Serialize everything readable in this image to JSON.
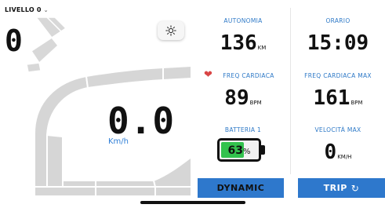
{
  "assist": {
    "label": "LIVELLO 0",
    "value": "0"
  },
  "speed": {
    "value": "0.0",
    "unit": "Km/h"
  },
  "stats": {
    "autonomia": {
      "label": "AUTONOMIA",
      "value": "136",
      "unit": "KM"
    },
    "orario": {
      "label": "ORARIO",
      "value": "15:09"
    },
    "freq_cardiaca": {
      "label": "FREQ CARDIACA",
      "value": "89",
      "unit": "BPM"
    },
    "freq_cardiaca_max": {
      "label": "FREQ CARDIACA MAX",
      "value": "161",
      "unit": "BPM"
    },
    "batteria": {
      "label": "BATTERIA 1",
      "value": "63",
      "unit": "%",
      "level": 0.63
    },
    "velocita_max": {
      "label": "VELOCITÀ MAX",
      "value": "0",
      "unit": "KM/H"
    }
  },
  "buttons": {
    "mode": "DYNAMIC",
    "trip": "TRIP"
  },
  "colors": {
    "accent": "#2e78cc",
    "battery_fill": "#33c24e",
    "heart": "#d94545"
  }
}
